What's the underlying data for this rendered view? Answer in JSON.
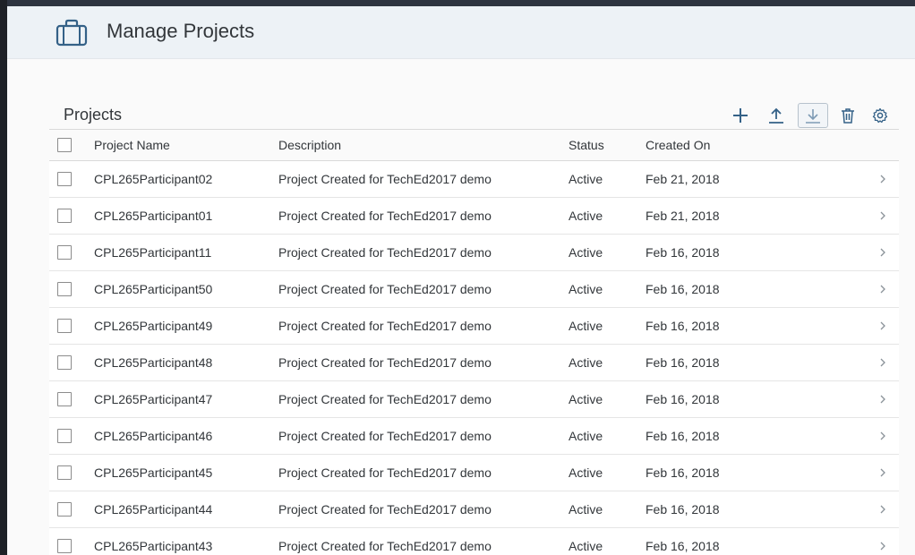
{
  "header": {
    "title": "Manage Projects",
    "icon": "briefcase-icon"
  },
  "toolbar": {
    "title": "Projects",
    "actions": [
      {
        "name": "add",
        "icon": "plus-icon"
      },
      {
        "name": "upload",
        "icon": "upload-icon"
      },
      {
        "name": "download",
        "icon": "download-icon"
      },
      {
        "name": "delete",
        "icon": "trash-icon"
      },
      {
        "name": "settings",
        "icon": "gear-icon"
      }
    ]
  },
  "table": {
    "columns": [
      "Project Name",
      "Description",
      "Status",
      "Created On"
    ],
    "rows": [
      {
        "name": "CPL265Participant02",
        "description": "Project Created for TechEd2017 demo",
        "status": "Active",
        "created": "Feb 21, 2018"
      },
      {
        "name": "CPL265Participant01",
        "description": "Project Created for TechEd2017 demo",
        "status": "Active",
        "created": "Feb 21, 2018"
      },
      {
        "name": "CPL265Participant11",
        "description": "Project Created for TechEd2017 demo",
        "status": "Active",
        "created": "Feb 16, 2018"
      },
      {
        "name": "CPL265Participant50",
        "description": "Project Created for TechEd2017 demo",
        "status": "Active",
        "created": "Feb 16, 2018"
      },
      {
        "name": "CPL265Participant49",
        "description": "Project Created for TechEd2017 demo",
        "status": "Active",
        "created": "Feb 16, 2018"
      },
      {
        "name": "CPL265Participant48",
        "description": "Project Created for TechEd2017 demo",
        "status": "Active",
        "created": "Feb 16, 2018"
      },
      {
        "name": "CPL265Participant47",
        "description": "Project Created for TechEd2017 demo",
        "status": "Active",
        "created": "Feb 16, 2018"
      },
      {
        "name": "CPL265Participant46",
        "description": "Project Created for TechEd2017 demo",
        "status": "Active",
        "created": "Feb 16, 2018"
      },
      {
        "name": "CPL265Participant45",
        "description": "Project Created for TechEd2017 demo",
        "status": "Active",
        "created": "Feb 16, 2018"
      },
      {
        "name": "CPL265Participant44",
        "description": "Project Created for TechEd2017 demo",
        "status": "Active",
        "created": "Feb 16, 2018"
      },
      {
        "name": "CPL265Participant43",
        "description": "Project Created for TechEd2017 demo",
        "status": "Active",
        "created": "Feb 16, 2018"
      }
    ]
  },
  "colors": {
    "accent": "#346187",
    "header_bg": "#edf2f6",
    "text": "#32363a"
  }
}
